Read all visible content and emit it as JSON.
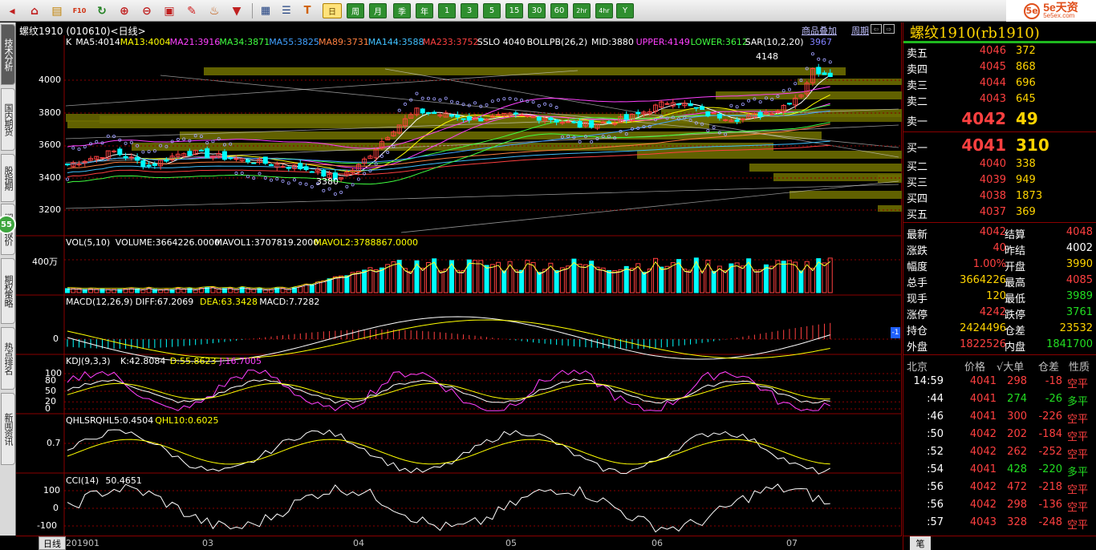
{
  "toolbar": {
    "icons": [
      "home-icon",
      "save-icon",
      "f10-icon",
      "refresh-icon",
      "zoom-in-icon",
      "zoom-out-icon",
      "window-icon",
      "draw-icon",
      "lamp-icon",
      "filter-icon"
    ],
    "icons2": [
      "table-icon",
      "list-icon",
      "tick-icon"
    ],
    "periods": [
      "日",
      "周",
      "月",
      "季",
      "年",
      "1",
      "3",
      "5",
      "15",
      "30",
      "60",
      "2hr",
      "4hr",
      "Y"
    ],
    "active_period": "日"
  },
  "logo": {
    "text": "5e天资",
    "sub": "5e5ex.com",
    "mark": "5e"
  },
  "left_tabs": [
    {
      "label": "技术分析",
      "active": true
    },
    {
      "label": "国内期货",
      "active": false
    },
    {
      "label": "股指期",
      "active": false
    },
    {
      "label": "期权报价",
      "active": false
    },
    {
      "label": "期权策略",
      "active": false
    },
    {
      "label": "热点排名",
      "active": false
    },
    {
      "label": "新闻资讯",
      "active": false
    }
  ],
  "left_badge": "55",
  "chart": {
    "title": "螺纹1910 (010610)<日线>",
    "links": [
      "商品叠加",
      "周期"
    ],
    "main_legend": [
      {
        "text": "K",
        "color": "#ffffff"
      },
      {
        "text": "MA5:4014",
        "color": "#ffffff"
      },
      {
        "text": "MA13:4004",
        "color": "#ffff00"
      },
      {
        "text": "MA21:3916",
        "color": "#ff40ff"
      },
      {
        "text": "MA34:3871",
        "color": "#40ff40"
      },
      {
        "text": "MA55:3825",
        "color": "#40a0ff"
      },
      {
        "text": "MA89:3731",
        "color": "#ff8040"
      },
      {
        "text": "MA144:3588",
        "color": "#40c0ff"
      },
      {
        "text": "MA233:3752",
        "color": "#ff4040"
      },
      {
        "text": "SSLO 4040",
        "color": "#ffffff"
      },
      {
        "text": "BOLLPB(26,2)",
        "color": "#ffffff"
      },
      {
        "text": "MID:3880",
        "color": "#ffffff"
      },
      {
        "text": "UPPER:4149",
        "color": "#ff40ff"
      },
      {
        "text": "LOWER:3612",
        "color": "#40ff40"
      },
      {
        "text": "SAR(10,2,20)",
        "color": "#ffffff"
      },
      {
        "text": "3967",
        "color": "#8080ff"
      }
    ],
    "price_labels": [
      "4000",
      "3800",
      "3600",
      "3400",
      "3200"
    ],
    "high_mark": "4148",
    "low_mark": "3380",
    "vol_legend": [
      {
        "text": "VOL(5,10)",
        "color": "#ffffff"
      },
      {
        "text": "VOLUME:3664226.0000",
        "color": "#ffffff"
      },
      {
        "text": "MAVOL1:3707819.2000",
        "color": "#ffffff"
      },
      {
        "text": "MAVOL2:3788867.0000",
        "color": "#ffff00"
      }
    ],
    "vol_label": "400万",
    "macd_legend": [
      {
        "text": "MACD(12,26,9)",
        "color": "#ffffff"
      },
      {
        "text": "DIFF:67.2069",
        "color": "#ffffff"
      },
      {
        "text": "DEA:63.3428",
        "color": "#ffff00"
      },
      {
        "text": "MACD:7.7282",
        "color": "#ffffff"
      }
    ],
    "macd_label": "0",
    "macd_marker": "-1",
    "kdj_legend": [
      {
        "text": "KDJ(9,3,3)",
        "color": "#ffffff"
      },
      {
        "text": "K:42.8084",
        "color": "#ffffff"
      },
      {
        "text": "D:55.8623",
        "color": "#ffff00"
      },
      {
        "text": "J:16.7005",
        "color": "#ff40ff"
      }
    ],
    "kdj_labels": [
      "100",
      "80",
      "50",
      "20",
      "0"
    ],
    "qhlsr_legend": [
      {
        "text": "QHLSR",
        "color": "#ffffff"
      },
      {
        "text": "QHL5:0.4504",
        "color": "#ffffff"
      },
      {
        "text": "QHL10:0.6025",
        "color": "#ffff00"
      }
    ],
    "qhlsr_label": "0.7",
    "cci_legend": [
      {
        "text": "CCI(14)",
        "color": "#ffffff"
      },
      {
        "text": "50.4651",
        "color": "#ffffff"
      }
    ],
    "cci_labels": [
      "100",
      "0",
      "-100"
    ],
    "x_tab": "日线",
    "x_dates": [
      "201901",
      "03",
      "04",
      "05",
      "06",
      "07"
    ]
  },
  "quote": {
    "title": "螺纹1910(rb1910)",
    "asks": [
      {
        "label": "卖五",
        "price": "4046",
        "vol": "372"
      },
      {
        "label": "卖四",
        "price": "4045",
        "vol": "868"
      },
      {
        "label": "卖三",
        "price": "4044",
        "vol": "696"
      },
      {
        "label": "卖二",
        "price": "4043",
        "vol": "645"
      },
      {
        "label": "卖一",
        "price": "4042",
        "vol": "49"
      }
    ],
    "bids": [
      {
        "label": "买一",
        "price": "4041",
        "vol": "310"
      },
      {
        "label": "买二",
        "price": "4040",
        "vol": "338"
      },
      {
        "label": "买三",
        "price": "4039",
        "vol": "949"
      },
      {
        "label": "买四",
        "price": "4038",
        "vol": "1873"
      },
      {
        "label": "买五",
        "price": "4037",
        "vol": "369"
      }
    ],
    "stats": [
      {
        "l1": "最新",
        "v1": "4042",
        "c1": "rd",
        "l2": "结算",
        "v2": "4048",
        "c2": "rd"
      },
      {
        "l1": "涨跌",
        "v1": "40",
        "c1": "rd",
        "l2": "昨结",
        "v2": "4002",
        "c2": "wt"
      },
      {
        "l1": "幅度",
        "v1": "1.00%",
        "c1": "rd",
        "l2": "开盘",
        "v2": "3990",
        "c2": "yw"
      },
      {
        "l1": "总手",
        "v1": "3664226",
        "c1": "yw",
        "l2": "最高",
        "v2": "4085",
        "c2": "rd"
      },
      {
        "l1": "现手",
        "v1": "120",
        "c1": "yw",
        "l2": "最低",
        "v2": "3989",
        "c2": "gr"
      },
      {
        "l1": "涨停",
        "v1": "4242",
        "c1": "rd",
        "l2": "跌停",
        "v2": "3761",
        "c2": "gr"
      },
      {
        "l1": "持仓",
        "v1": "2424496",
        "c1": "yw",
        "l2": "仓差",
        "v2": "23532",
        "c2": "yw"
      },
      {
        "l1": "外盘",
        "v1": "1822526",
        "c1": "rd",
        "l2": "内盘",
        "v2": "1841700",
        "c2": "gr"
      }
    ],
    "tick_head": {
      "place": "北京",
      "price": "价格",
      "vol": "√大单",
      "diff": "仓差",
      "nature": "性质"
    },
    "ticks": [
      {
        "time": "14:59",
        "price": "4041",
        "vol": "298",
        "diff": "-18",
        "nature": "空平",
        "vc": "rd",
        "nc": "rd"
      },
      {
        "time": ":44",
        "price": "4041",
        "vol": "274",
        "diff": "-26",
        "nature": "多平",
        "vc": "gr",
        "nc": "gr"
      },
      {
        "time": ":46",
        "price": "4041",
        "vol": "300",
        "diff": "-226",
        "nature": "空平",
        "vc": "rd",
        "nc": "rd"
      },
      {
        "time": ":50",
        "price": "4042",
        "vol": "202",
        "diff": "-184",
        "nature": "空平",
        "vc": "rd",
        "nc": "rd"
      },
      {
        "time": ":52",
        "price": "4042",
        "vol": "262",
        "diff": "-252",
        "nature": "空平",
        "vc": "rd",
        "nc": "rd"
      },
      {
        "time": ":54",
        "price": "4041",
        "vol": "428",
        "diff": "-220",
        "nature": "多平",
        "vc": "gr",
        "nc": "gr"
      },
      {
        "time": ":56",
        "price": "4042",
        "vol": "472",
        "diff": "-218",
        "nature": "空平",
        "vc": "rd",
        "nc": "rd"
      },
      {
        "time": ":56",
        "price": "4042",
        "vol": "298",
        "diff": "-136",
        "nature": "空平",
        "vc": "rd",
        "nc": "rd"
      },
      {
        "time": ":57",
        "price": "4043",
        "vol": "328",
        "diff": "-248",
        "nature": "空平",
        "vc": "rd",
        "nc": "rd"
      }
    ],
    "bottom_tab": "笔"
  },
  "colors": {
    "up": "#ff4040",
    "down": "#00ffff",
    "panel_border": "#8a0000",
    "volume_profile": "#6b6b00"
  }
}
